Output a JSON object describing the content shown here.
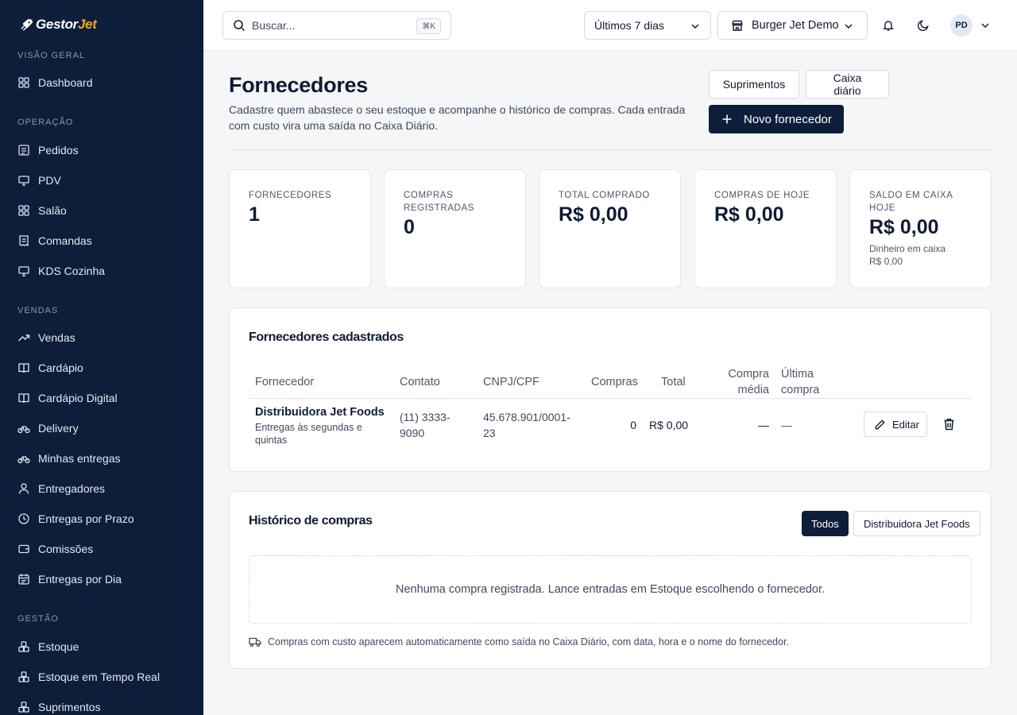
{
  "brand": {
    "name_prefix": "Gestor",
    "name_suffix": "Jet"
  },
  "sidebar": {
    "sections": [
      {
        "label": "Visão geral",
        "items": [
          {
            "label": "Dashboard",
            "icon": "grid-icon"
          }
        ]
      },
      {
        "label": "Operação",
        "items": [
          {
            "label": "Pedidos",
            "icon": "list-icon"
          },
          {
            "label": "PDV",
            "icon": "monitor-icon"
          },
          {
            "label": "Salão",
            "icon": "grid-icon"
          },
          {
            "label": "Comandas",
            "icon": "receipt-icon"
          },
          {
            "label": "KDS Cozinha",
            "icon": "monitor-icon"
          }
        ]
      },
      {
        "label": "Vendas",
        "items": [
          {
            "label": "Vendas",
            "icon": "trend-icon"
          },
          {
            "label": "Cardápio",
            "icon": "book-icon"
          },
          {
            "label": "Cardápio Digital",
            "icon": "book-icon"
          },
          {
            "label": "Delivery",
            "icon": "bike-icon"
          },
          {
            "label": "Minhas entregas",
            "icon": "bike-icon"
          },
          {
            "label": "Entregadores",
            "icon": "user-icon"
          },
          {
            "label": "Entregas por Prazo",
            "icon": "clock-icon"
          },
          {
            "label": "Comissões",
            "icon": "wallet-icon"
          },
          {
            "label": "Entregas por Dia",
            "icon": "calendar-icon"
          }
        ]
      },
      {
        "label": "Gestão",
        "items": [
          {
            "label": "Estoque",
            "icon": "boxes-icon"
          },
          {
            "label": "Estoque em Tempo Real",
            "icon": "boxes-icon"
          },
          {
            "label": "Suprimentos",
            "icon": "boxes-icon"
          }
        ]
      }
    ]
  },
  "header": {
    "search_placeholder": "Buscar...",
    "search_shortcut": "⌘K",
    "period_select": "Últimos 7 dias",
    "store_select": "Burger Jet Demo",
    "avatar_initials": "PD"
  },
  "page": {
    "title": "Fornecedores",
    "subtitle": "Cadastre quem abastece o seu estoque e acompanhe o histórico de compras. Cada entrada com custo vira uma saída no Caixa Diário.",
    "btn_suprimentos": "Suprimentos",
    "btn_caixa": "Caixa diário",
    "btn_novo": "Novo fornecedor"
  },
  "stats": [
    {
      "label": "Fornecedores",
      "value": "1"
    },
    {
      "label": "Compras registradas",
      "value": "0"
    },
    {
      "label": "Total comprado",
      "value": "R$ 0,00"
    },
    {
      "label": "Compras de hoje",
      "value": "R$ 0,00"
    },
    {
      "label": "Saldo em caixa hoje",
      "value": "R$ 0,00",
      "extra_label": "Dinheiro em caixa",
      "extra_value": "R$ 0,00"
    }
  ],
  "suppliers": {
    "title": "Fornecedores cadastrados",
    "columns": {
      "fornecedor": "Fornecedor",
      "contato": "Contato",
      "cnpj": "CNPJ/CPF",
      "compras": "Compras",
      "total": "Total",
      "compra_media_1": "Compra",
      "compra_media_2": "média",
      "ultima_1": "Última",
      "ultima_2": "compra"
    },
    "rows": [
      {
        "name": "Distribuidora Jet Foods",
        "note_1": "Entregas às segundas e",
        "note_2": "quintas",
        "contato_1": "(11) 3333-",
        "contato_2": "9090",
        "cnpj_1": "45.678.901/0001-",
        "cnpj_2": "23",
        "compras": "0",
        "total": "R$ 0,00",
        "media": "—",
        "ultima": "—",
        "edit_label": "Editar"
      }
    ]
  },
  "history": {
    "title": "Histórico de compras",
    "filters": [
      "Todos",
      "Distribuidora Jet Foods"
    ],
    "empty_text": "Nenhuma compra registrada. Lance entradas em Estoque escolhendo o fornecedor.",
    "footnote": "Compras com custo aparecem automaticamente como saída no Caixa Diário, com data, hora e o nome do fornecedor."
  }
}
